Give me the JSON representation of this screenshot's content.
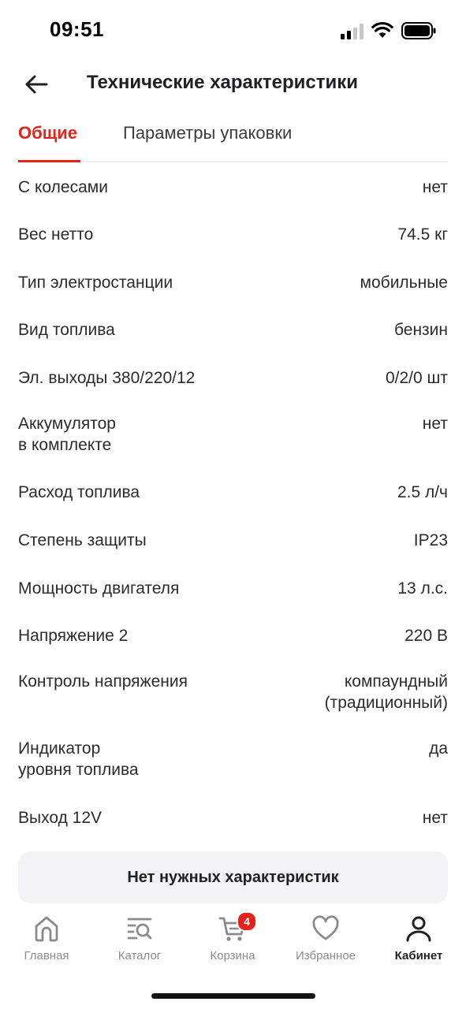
{
  "status_bar": {
    "time": "09:51"
  },
  "header": {
    "title": "Технические характеристики"
  },
  "tabs": [
    {
      "label": "Общие",
      "active": true
    },
    {
      "label": "Параметры упаковки",
      "active": false
    }
  ],
  "specs": [
    {
      "label": "С колесами",
      "value": "нет"
    },
    {
      "label": "Вес нетто",
      "value": "74.5 кг"
    },
    {
      "label": "Тип электростанции",
      "value": "мобильные"
    },
    {
      "label": "Вид топлива",
      "value": "бензин"
    },
    {
      "label": "Эл. выходы 380/220/12",
      "value": "0/2/0 шт"
    },
    {
      "label": "Аккумулятор\nв комплекте",
      "value": "нет"
    },
    {
      "label": "Расход топлива",
      "value": "2.5 л/ч"
    },
    {
      "label": "Степень защиты",
      "value": "IP23"
    },
    {
      "label": "Мощность двигателя",
      "value": "13 л.с."
    },
    {
      "label": "Напряжение 2",
      "value": "220 В"
    },
    {
      "label": "Контроль напряжения",
      "value": "компаундный\n(традиционный)"
    },
    {
      "label": "Индикатор\nуровня топлива",
      "value": "да"
    },
    {
      "label": "Выход 12V",
      "value": "нет"
    }
  ],
  "missing_button": {
    "label": "Нет нужных характеристик"
  },
  "tabbar": [
    {
      "label": "Главная",
      "icon": "home-icon",
      "active": false
    },
    {
      "label": "Каталог",
      "icon": "catalog-search-icon",
      "active": false
    },
    {
      "label": "Корзина",
      "icon": "cart-icon",
      "active": false,
      "badge": "4"
    },
    {
      "label": "Избранное",
      "icon": "heart-icon",
      "active": false
    },
    {
      "label": "Кабинет",
      "icon": "user-icon",
      "active": true
    }
  ],
  "colors": {
    "accent": "#e2231a",
    "text": "#1f2024",
    "muted": "#8a8a8f"
  }
}
